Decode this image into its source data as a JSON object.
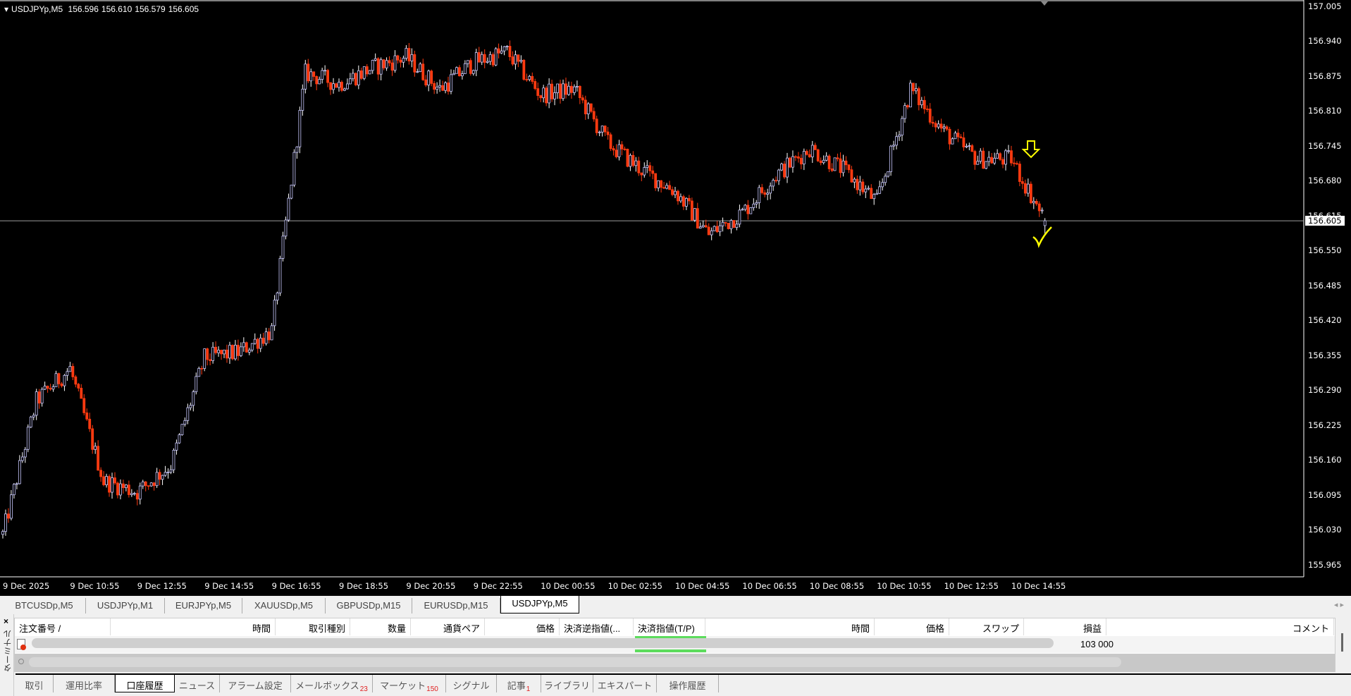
{
  "header": {
    "symbol": "USDJPYp,M5",
    "open": "156.596",
    "high": "156.610",
    "low": "156.579",
    "close": "156.605"
  },
  "price_axis": [
    "157.005",
    "156.940",
    "156.875",
    "156.810",
    "156.745",
    "156.680",
    "156.615",
    "156.550",
    "156.485",
    "156.420",
    "156.355",
    "156.290",
    "156.225",
    "156.160",
    "156.095",
    "156.030",
    "155.965"
  ],
  "current_price": "156.605",
  "time_axis": [
    "9 Dec 2025",
    "9 Dec 10:55",
    "9 Dec 12:55",
    "9 Dec 14:55",
    "9 Dec 16:55",
    "9 Dec 18:55",
    "9 Dec 20:55",
    "9 Dec 22:55",
    "10 Dec 00:55",
    "10 Dec 02:55",
    "10 Dec 04:55",
    "10 Dec 06:55",
    "10 Dec 08:55",
    "10 Dec 10:55",
    "10 Dec 12:55",
    "10 Dec 14:55"
  ],
  "chart_data": {
    "type": "candlestick",
    "symbol": "USDJPYp",
    "timeframe": "M5",
    "ylim": [
      155.965,
      157.005
    ],
    "bull_color": "#ffffff",
    "bear_color": "#ff3a10",
    "annotation_color": "#ffff00",
    "last_bar": {
      "open": 156.596,
      "high": 156.61,
      "low": 156.579,
      "close": 156.605
    },
    "approx_hourly_close": [
      156.021,
      156.27,
      156.33,
      156.12,
      156.1,
      156.15,
      156.35,
      156.36,
      156.4,
      156.88,
      156.86,
      156.89,
      156.91,
      156.85,
      156.9,
      156.92,
      156.84,
      156.85,
      156.75,
      156.7,
      156.66,
      156.58,
      156.62,
      156.69,
      156.74,
      156.7,
      156.64,
      156.85,
      156.77,
      156.72,
      156.72,
      156.605
    ],
    "annotations": [
      "down-arrow-icon",
      "checkmark-icon"
    ]
  },
  "chart_tabs": [
    "BTCUSDp,M5",
    "USDJPYp,M1",
    "EURJPYp,M5",
    "XAUUSDp,M5",
    "GBPUSDp,M15",
    "EURUSDp,M15",
    "USDJPYp,M5"
  ],
  "terminal": {
    "close": "×",
    "title": "ターミナル",
    "columns": [
      "注文番号 /",
      "時間",
      "取引種別",
      "数量",
      "通貨ペア",
      "価格",
      "決済逆指値(...",
      "決済指値(T/P)",
      "時間",
      "価格",
      "スワップ",
      "損益",
      "コメント"
    ],
    "profit": "103 000"
  },
  "bottom_tabs": [
    {
      "label": "取引"
    },
    {
      "label": "運用比率"
    },
    {
      "label": "口座履歴"
    },
    {
      "label": "ニュース"
    },
    {
      "label": "アラーム設定"
    },
    {
      "label": "メールボックス",
      "badge": "23"
    },
    {
      "label": "マーケット",
      "badge": "150"
    },
    {
      "label": "シグナル"
    },
    {
      "label": "記事",
      "badge": "1"
    },
    {
      "label": "ライブラリ"
    },
    {
      "label": "エキスパート"
    },
    {
      "label": "操作履歴"
    }
  ]
}
